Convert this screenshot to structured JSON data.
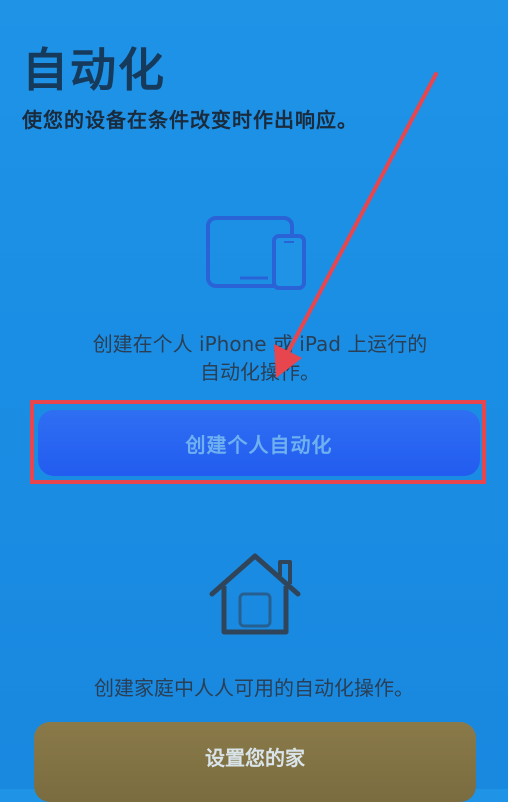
{
  "header": {
    "title": "自动化",
    "subtitle": "使您的设备在条件改变时作出响应。"
  },
  "personal": {
    "description_line1": "创建在个人 iPhone 或 iPad 上运行的",
    "description_line2": "自动化操作。",
    "button_label": "创建个人自动化"
  },
  "home": {
    "description": "创建家庭中人人可用的自动化操作。",
    "button_label": "设置您的家"
  },
  "colors": {
    "background": "#1a8ee4",
    "primary_button": "#225cf0",
    "secondary_button": "#7a6c3f",
    "annotation_red": "#e8464f"
  },
  "icons": [
    "iphone-ipad-icon",
    "home-icon"
  ]
}
